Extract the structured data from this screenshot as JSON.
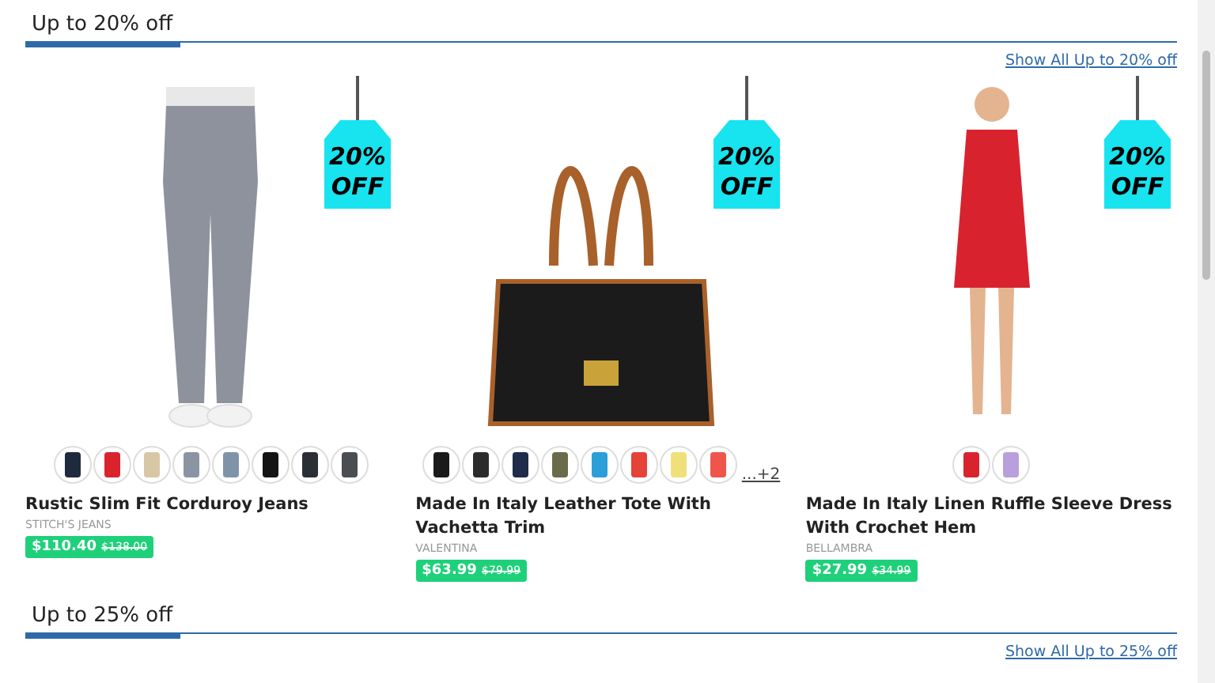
{
  "sections": [
    {
      "title": "Up to 20% off",
      "link": "Show All Up to 20% off",
      "products": [
        {
          "kind": "jeans",
          "badge": [
            "20%",
            "OFF"
          ],
          "swatches": [
            {
              "color": "#1f2a3c"
            },
            {
              "color": "#d9242e"
            },
            {
              "color": "#d8c7a5"
            },
            {
              "color": "#8a94a3"
            },
            {
              "color": "#7f93a8"
            },
            {
              "color": "#141414"
            },
            {
              "color": "#2a3036"
            },
            {
              "color": "#4a4d52"
            }
          ],
          "name": "Rustic Slim Fit Corduroy Jeans",
          "brand": "STITCH'S JEANS",
          "price": "$110.40",
          "was": "$138.00"
        },
        {
          "kind": "bag",
          "badge": [
            "20%",
            "OFF"
          ],
          "swatches": [
            {
              "color": "#1a1a1a"
            },
            {
              "color": "#2c2c2c"
            },
            {
              "color": "#1f2c4a"
            },
            {
              "color": "#6b6a4a"
            },
            {
              "color": "#2a9fd8"
            },
            {
              "color": "#e5423a"
            },
            {
              "color": "#f0e07a"
            },
            {
              "color": "#f0554c"
            }
          ],
          "more": "...+2",
          "name": "Made In Italy Leather Tote With Vachetta Trim",
          "brand": "VALENTINA",
          "price": "$63.99",
          "was": "$79.99"
        },
        {
          "kind": "dress",
          "badge": [
            "20%",
            "OFF"
          ],
          "swatches": [
            {
              "color": "#d8232f"
            },
            {
              "color": "#b9a0dc"
            }
          ],
          "name": "Made In Italy Linen Ruffle Sleeve Dress With Crochet Hem",
          "brand": "BELLAMBRA",
          "price": "$27.99",
          "was": "$34.99"
        }
      ]
    },
    {
      "title": "Up to 25% off",
      "link": "Show All Up to 25% off"
    }
  ]
}
